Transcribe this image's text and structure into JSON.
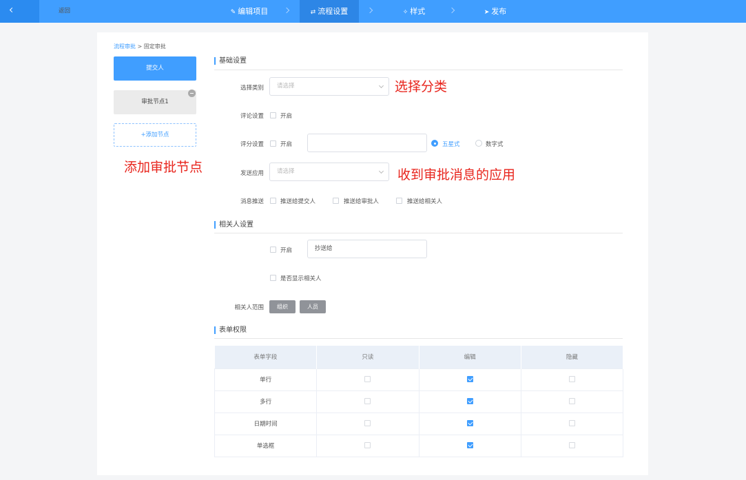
{
  "nav": {
    "back_label": "返回",
    "steps": [
      {
        "label": "编辑项目",
        "icon": "edit-icon",
        "glyph": "✎",
        "active": false
      },
      {
        "label": "流程设置",
        "icon": "flow-icon",
        "glyph": "⇄",
        "active": true
      },
      {
        "label": "样式",
        "icon": "style-icon",
        "glyph": "✧",
        "active": false
      },
      {
        "label": "发布",
        "icon": "send-icon",
        "glyph": "➤",
        "active": false
      }
    ]
  },
  "breadcrumb": {
    "parent": "流程审批",
    "separator": ">",
    "current": "固定审批"
  },
  "flow": {
    "submitter_node": "提交人",
    "approval_node": "审批节点1",
    "add_node": "+添加节点"
  },
  "annotations": {
    "category": "选择分类",
    "add_node": "添加审批节点",
    "app": "收到审批消息的应用"
  },
  "basic": {
    "title": "基础设置",
    "category": {
      "label": "选择类别",
      "placeholder": "请选择"
    },
    "comment": {
      "label": "评论设置",
      "option": "开启",
      "checked": false
    },
    "rating": {
      "label": "评分设置",
      "option": "开启",
      "checked": false,
      "value": "",
      "modes": [
        {
          "label": "五星式",
          "selected": true
        },
        {
          "label": "数字式",
          "selected": false
        }
      ]
    },
    "send_app": {
      "label": "发送应用",
      "placeholder": "请选择"
    },
    "push": {
      "label": "消息推送",
      "options": [
        {
          "label": "推送给提交人",
          "checked": false
        },
        {
          "label": "推送给审批人",
          "checked": false
        },
        {
          "label": "推送给相关人",
          "checked": false
        }
      ]
    }
  },
  "related": {
    "title": "相关人设置",
    "enable": {
      "label": "开启",
      "checked": false
    },
    "cc_value": "抄送给",
    "show_related": {
      "label": "是否显示相关人",
      "checked": false
    },
    "scope_label": "相关人范围",
    "scope_tags": [
      "组织",
      "人员"
    ]
  },
  "permissions": {
    "title": "表单权限",
    "headers": [
      "表单字段",
      "只读",
      "编辑",
      "隐藏"
    ],
    "rows": [
      {
        "field": "单行",
        "readonly": false,
        "edit": true,
        "hidden": false
      },
      {
        "field": "多行",
        "readonly": false,
        "edit": true,
        "hidden": false
      },
      {
        "field": "日期时间",
        "readonly": false,
        "edit": true,
        "hidden": false
      },
      {
        "field": "单选框",
        "readonly": false,
        "edit": true,
        "hidden": false
      }
    ]
  },
  "colors": {
    "primary": "#409eff",
    "annotation": "#e8251d",
    "tag": "#909399"
  }
}
